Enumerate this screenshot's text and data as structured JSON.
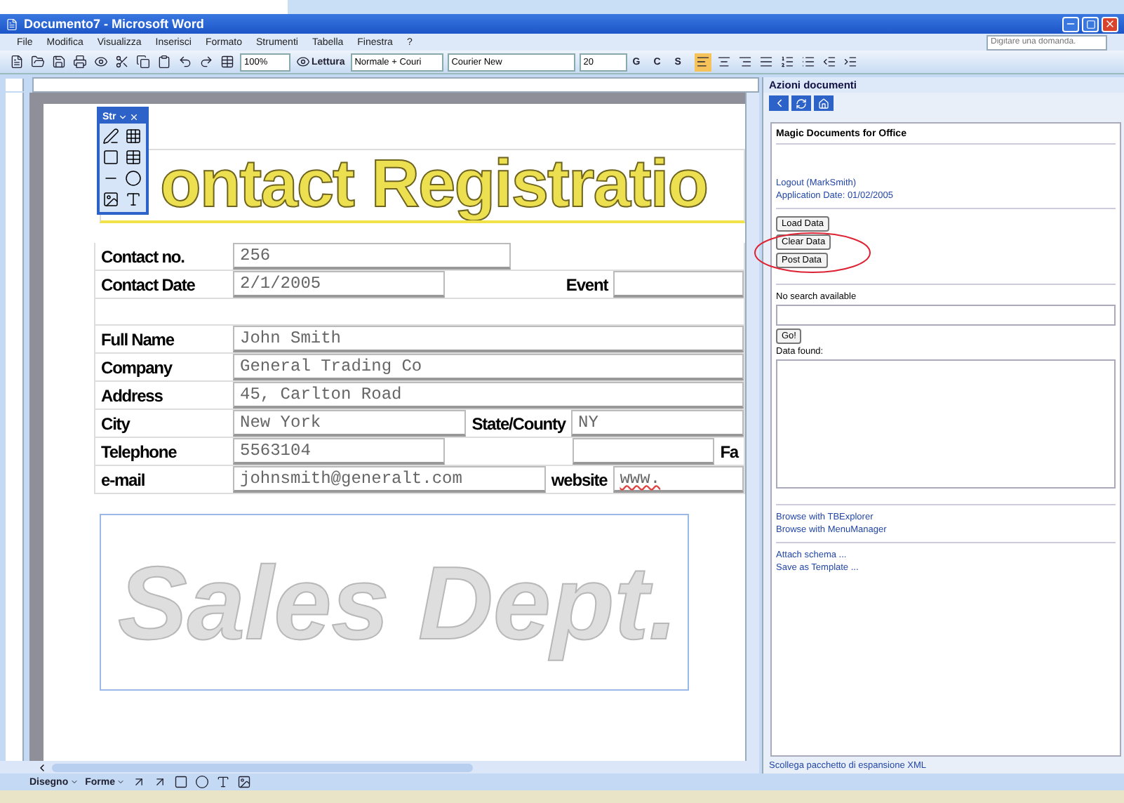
{
  "window": {
    "title": "Documento7 - Microsoft Word"
  },
  "menu": [
    "File",
    "Modifica",
    "Visualizza",
    "Inserisci",
    "Formato",
    "Strumenti",
    "Tabella",
    "Finestra",
    "?"
  ],
  "help_box": {
    "placeholder": "Digitare una domanda."
  },
  "toolbar": {
    "zoom": "100%",
    "reading": "Lettura",
    "style": "Normale + Couri",
    "font": "Courier New",
    "size": "20",
    "format_buttons": [
      "G",
      "C",
      "S"
    ]
  },
  "floating_toolbar": {
    "title": "Str"
  },
  "document": {
    "heading": "ontact Registratio",
    "form_rows": [
      [
        {
          "kind": "label",
          "text": "Contact no."
        },
        {
          "kind": "value",
          "text": "256"
        },
        {
          "kind": "empty"
        }
      ],
      [
        {
          "kind": "label",
          "text": "Contact Date"
        },
        {
          "kind": "value",
          "text": "2/1/2005"
        },
        {
          "kind": "empty"
        },
        {
          "kind": "label",
          "text": "Event"
        },
        {
          "kind": "value",
          "text": ""
        }
      ],
      [
        {
          "kind": "empty"
        }
      ],
      [
        {
          "kind": "label",
          "text": "Full Name"
        },
        {
          "kind": "value",
          "text": "John Smith"
        }
      ],
      [
        {
          "kind": "label",
          "text": "Company"
        },
        {
          "kind": "value",
          "text": "General Trading Co"
        }
      ],
      [
        {
          "kind": "label",
          "text": "Address"
        },
        {
          "kind": "value",
          "text": "45, Carlton Road"
        }
      ],
      [
        {
          "kind": "label",
          "text": "City"
        },
        {
          "kind": "value",
          "text": "New York"
        },
        {
          "kind": "label",
          "text": "State/County"
        },
        {
          "kind": "value",
          "text": "NY"
        }
      ],
      [
        {
          "kind": "label",
          "text": "Telephone"
        },
        {
          "kind": "value",
          "text": "5563104"
        },
        {
          "kind": "empty"
        },
        {
          "kind": "value",
          "text": ""
        },
        {
          "kind": "label",
          "text": "Fa"
        }
      ],
      [
        {
          "kind": "label",
          "text": "e-mail"
        },
        {
          "kind": "value",
          "text": "johnsmith@generalt.com"
        },
        {
          "kind": "label",
          "text": "website"
        },
        {
          "kind": "link",
          "text": "www."
        }
      ]
    ],
    "banner": "Sales Dept."
  },
  "task_pane": {
    "title": "Azioni documenti",
    "heading": "Magic Documents for Office",
    "user_links": [
      "Logout (MarkSmith)",
      "Application Date: 01/02/2005"
    ],
    "buttons": [
      {
        "label": "Load Data",
        "circled": false
      },
      {
        "label": "Clear Data",
        "circled": true
      },
      {
        "label": "Post Data",
        "circled": true
      }
    ],
    "search_label": "No search available",
    "go_button": "Go!",
    "results_label": "Data found:",
    "browse_links": [
      "Browse with TBExplorer",
      "Browse with MenuManager"
    ],
    "schema_links": [
      "Attach schema ...",
      "Save as Template ..."
    ],
    "footer_link": "Scollega pacchetto di espansione XML"
  },
  "drawing_toolbar": {
    "draw_menu": "Disegno",
    "shapes_menu": "Forme"
  }
}
